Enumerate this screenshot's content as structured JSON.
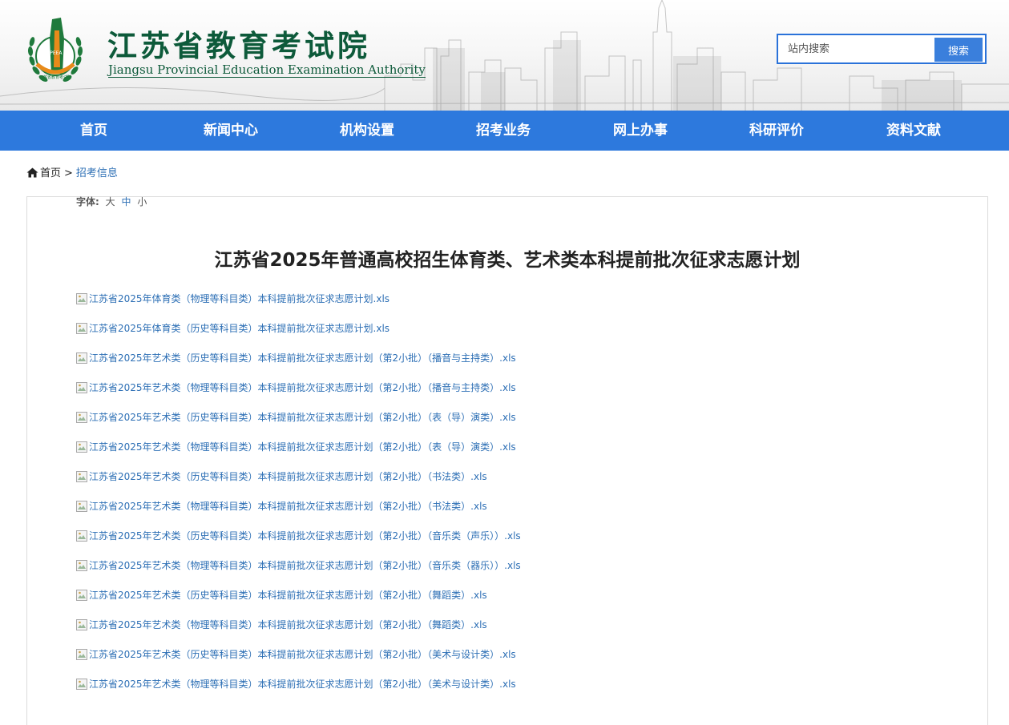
{
  "header": {
    "org_name_cn": "江苏省教育考试院",
    "org_name_en": "Jiangsu Provincial Education Examination Authority",
    "emblem_text": "江苏省教育考试院",
    "search": {
      "placeholder": "站内搜索",
      "value": "",
      "button_label": "搜索"
    }
  },
  "nav": {
    "items": [
      {
        "label": "首页"
      },
      {
        "label": "新闻中心"
      },
      {
        "label": "机构设置"
      },
      {
        "label": "招考业务"
      },
      {
        "label": "网上办事"
      },
      {
        "label": "科研评价"
      },
      {
        "label": "资料文献"
      }
    ]
  },
  "breadcrumb": {
    "icon": "home-icon",
    "home": "首页",
    "separator": ">",
    "current": "招考信息"
  },
  "font_size": {
    "label": "字体:",
    "options": [
      "大",
      "中",
      "小"
    ],
    "active": "中"
  },
  "article": {
    "title": "江苏省2025年普通高校招生体育类、艺术类本科提前批次征求志愿计划",
    "attachments": [
      "江苏省2025年体育类（物理等科目类）本科提前批次征求志愿计划.xls",
      "江苏省2025年体育类（历史等科目类）本科提前批次征求志愿计划.xls",
      "江苏省2025年艺术类（历史等科目类）本科提前批次征求志愿计划（第2小批）（播音与主持类）.xls",
      "江苏省2025年艺术类（物理等科目类）本科提前批次征求志愿计划（第2小批）（播音与主持类）.xls",
      "江苏省2025年艺术类（历史等科目类）本科提前批次征求志愿计划（第2小批）（表（导）演类）.xls",
      "江苏省2025年艺术类（物理等科目类）本科提前批次征求志愿计划（第2小批）（表（导）演类）.xls",
      "江苏省2025年艺术类（历史等科目类）本科提前批次征求志愿计划（第2小批）（书法类）.xls",
      "江苏省2025年艺术类（物理等科目类）本科提前批次征求志愿计划（第2小批）（书法类）.xls",
      "江苏省2025年艺术类（历史等科目类）本科提前批次征求志愿计划（第2小批）（音乐类（声乐））.xls",
      "江苏省2025年艺术类（物理等科目类）本科提前批次征求志愿计划（第2小批）（音乐类（器乐））.xls",
      "江苏省2025年艺术类（历史等科目类）本科提前批次征求志愿计划（第2小批）（舞蹈类）.xls",
      "江苏省2025年艺术类（物理等科目类）本科提前批次征求志愿计划（第2小批）（舞蹈类）.xls",
      "江苏省2025年艺术类（历史等科目类）本科提前批次征求志愿计划（第2小批）（美术与设计类）.xls",
      "江苏省2025年艺术类（物理等科目类）本科提前批次征求志愿计划（第2小批）（美术与设计类）.xls"
    ]
  },
  "colors": {
    "nav_bg": "#2d79dd",
    "link": "#2d6fb5",
    "logo_green": "#0d5a3a",
    "search_border": "#2a72d9"
  }
}
